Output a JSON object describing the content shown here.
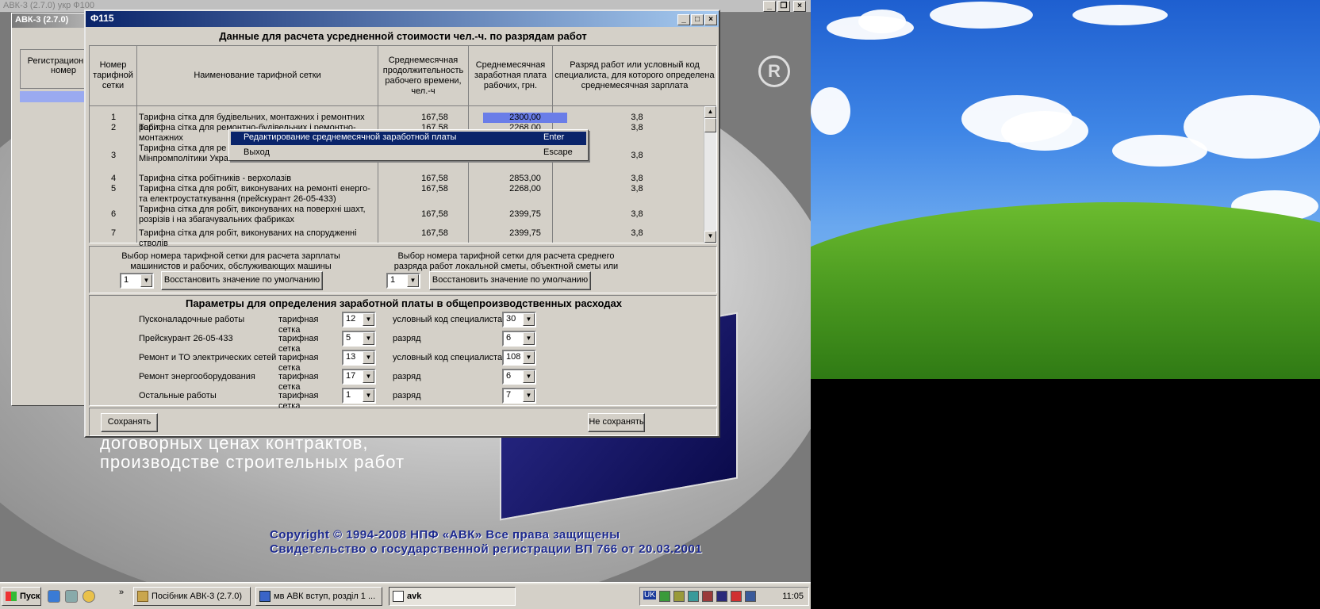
{
  "app": {
    "title_bar_text": "АВК-3 (2.7.0)   укр                                    Ф100",
    "behind_window_title": "АВК-3 (2.7.0)",
    "behind_window_column": "Регистрационный номер"
  },
  "background": {
    "line1": "договорных ценах контрактов,",
    "line2": "производстве строительных работ",
    "copyright": "Copyright ©  1994-2008 НПФ «АВК» Все права защищены",
    "certificate": "Свидетельство о государственной регистрации ВП   766 от 20.03.2001",
    "reg_mark": "R"
  },
  "dialog": {
    "title": "Ф115",
    "heading": "Данные для расчета усредненной стоимости чел.-ч. по разрядам работ",
    "columns": {
      "no": "Номер тарифной сетки",
      "name": "Наименование тарифной сетки",
      "duration": "Среднемесячная продолжительность рабочего времени, чел.-ч",
      "salary": "Среднемесячная заработная плата рабочих, грн.",
      "rank": "Разряд работ или условный код специалиста, для которого определена среднемесячная зарплата"
    },
    "rows": [
      {
        "no": "1",
        "name": "Тарифна сітка для будівельних, монтажних і ремонтних робіт",
        "duration": "167,58",
        "salary": "2300,00",
        "rank": "3,8"
      },
      {
        "no": "2",
        "name": "Тарифна сітка для ремонтно-будівельних і ремонтно-монтажних",
        "duration": "167,58",
        "salary": "2268,00",
        "rank": "3,8"
      },
      {
        "no": "3",
        "name": "Тарифна сітка для ре ремонтно-монтажних праці Мінпромполітики України",
        "duration": "",
        "salary": "",
        "rank": "3,8"
      },
      {
        "no": "4",
        "name": "Тарифна сітка робітників - верхолазів",
        "duration": "167,58",
        "salary": "2853,00",
        "rank": "3,8"
      },
      {
        "no": "5",
        "name": "Тарифна сітка для робіт, виконуваних на ремонті енерго- та електроустаткування (прейскурант 26-05-433)",
        "duration": "167,58",
        "salary": "2268,00",
        "rank": "3,8"
      },
      {
        "no": "6",
        "name": "Тарифна сітка для робіт, виконуваних на поверхні шахт, розрізів і на збагачувальних фабриках",
        "duration": "167,58",
        "salary": "2399,75",
        "rank": "3,8"
      },
      {
        "no": "7",
        "name": "Тарифна сітка для робіт, виконуваних на спорудженні стволів",
        "duration": "167,58",
        "salary": "2399,75",
        "rank": "3,8"
      }
    ],
    "context_menu": [
      {
        "label": "Редактирование среднемесячной заработной платы",
        "shortcut": "Enter"
      },
      {
        "label": "Выход",
        "shortcut": "Escape"
      }
    ],
    "select_left": {
      "label": "Выбор номера тарифной сетки для расчета зарплаты машинистов и рабочих, обслуживающих машины",
      "value": "1",
      "reset_label": "Восстановить значение по умолчанию"
    },
    "select_right": {
      "label": "Выбор номера тарифной сетки для расчета среднего разряда работ локальной сметы, объектной сметы или стройки",
      "value": "1",
      "reset_label": "Восстановить значение по умолчанию"
    },
    "params_heading": "Параметры для определения заработной платы в общепроизводственных расходах",
    "params": [
      {
        "name": "Пусконаладочные работы",
        "grid_label": "тарифная сетка",
        "grid": "12",
        "code_label": "условный код специалиста",
        "code": "30"
      },
      {
        "name": "Прейскурант 26-05-433",
        "grid_label": "тарифная сетка",
        "grid": "5",
        "code_label": "разряд",
        "code": "6"
      },
      {
        "name": "Ремонт и ТО электрических сетей",
        "grid_label": "тарифная сетка",
        "grid": "13",
        "code_label": "условный код специалиста",
        "code": "108"
      },
      {
        "name": "Ремонт энергооборудования",
        "grid_label": "тарифная сетка",
        "grid": "17",
        "code_label": "разряд",
        "code": "6"
      },
      {
        "name": "Остальные работы",
        "grid_label": "тарифная сетка",
        "grid": "1",
        "code_label": "разряд",
        "code": "7"
      }
    ],
    "save_label": "Сохранять",
    "nosave_label": "Не сохранять"
  },
  "taskbar": {
    "start": "Пуск",
    "tasks": [
      "Посібник АВК-3 (2.7.0)",
      "мв АВК вступ, розділ 1 ...",
      "avk"
    ],
    "lang": "UK",
    "clock": "11:05"
  }
}
